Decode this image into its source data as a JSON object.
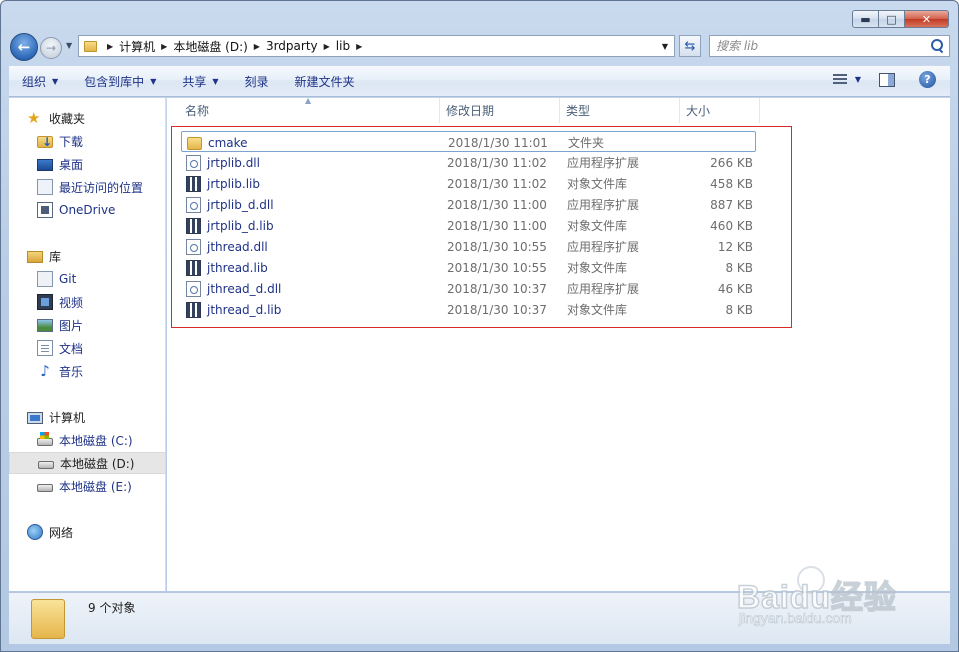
{
  "window": {
    "caption_buttons": {
      "minimize": "▬",
      "maximize": "□",
      "close": "✕"
    }
  },
  "address_bar": {
    "crumbs": [
      "计算机",
      "本地磁盘 (D:)",
      "3rdparty",
      "lib"
    ]
  },
  "search": {
    "placeholder": "搜索 lib"
  },
  "toolbar": {
    "organize": "组织",
    "include_in_library": "包含到库中",
    "share": "共享",
    "burn": "刻录",
    "new_folder": "新建文件夹"
  },
  "nav": {
    "favorites": {
      "label": "收藏夹",
      "items": [
        "下载",
        "桌面",
        "最近访问的位置",
        "OneDrive"
      ]
    },
    "libraries": {
      "label": "库",
      "items": [
        "Git",
        "视频",
        "图片",
        "文档",
        "音乐"
      ]
    },
    "computer": {
      "label": "计算机",
      "items": [
        "本地磁盘 (C:)",
        "本地磁盘 (D:)",
        "本地磁盘 (E:)"
      ]
    },
    "network": {
      "label": "网络"
    }
  },
  "columns": {
    "name": "名称",
    "modified": "修改日期",
    "type": "类型",
    "size": "大小"
  },
  "files": [
    {
      "name": "cmake",
      "modified": "2018/1/30 11:01",
      "type": "文件夹",
      "size": "",
      "icon": "folder-icon"
    },
    {
      "name": "jrtplib.dll",
      "modified": "2018/1/30 11:02",
      "type": "应用程序扩展",
      "size": "266 KB",
      "icon": "dll-icon"
    },
    {
      "name": "jrtplib.lib",
      "modified": "2018/1/30 11:02",
      "type": "对象文件库",
      "size": "458 KB",
      "icon": "lib-icon"
    },
    {
      "name": "jrtplib_d.dll",
      "modified": "2018/1/30 11:00",
      "type": "应用程序扩展",
      "size": "887 KB",
      "icon": "dll-icon"
    },
    {
      "name": "jrtplib_d.lib",
      "modified": "2018/1/30 11:00",
      "type": "对象文件库",
      "size": "460 KB",
      "icon": "lib-icon"
    },
    {
      "name": "jthread.dll",
      "modified": "2018/1/30 10:55",
      "type": "应用程序扩展",
      "size": "12 KB",
      "icon": "dll-icon"
    },
    {
      "name": "jthread.lib",
      "modified": "2018/1/30 10:55",
      "type": "对象文件库",
      "size": "8 KB",
      "icon": "lib-icon"
    },
    {
      "name": "jthread_d.dll",
      "modified": "2018/1/30 10:37",
      "type": "应用程序扩展",
      "size": "46 KB",
      "icon": "dll-icon"
    },
    {
      "name": "jthread_d.lib",
      "modified": "2018/1/30 10:37",
      "type": "对象文件库",
      "size": "8 KB",
      "icon": "lib-icon"
    }
  ],
  "status": {
    "count_text": "9 个对象"
  },
  "watermark": {
    "main": "Baidu经验",
    "sub": "jingyan.baidu.com"
  },
  "colors": {
    "link_blue": "#1e3287",
    "highlight_red": "#d52b2b",
    "meta_gray": "#6d6d6d"
  }
}
